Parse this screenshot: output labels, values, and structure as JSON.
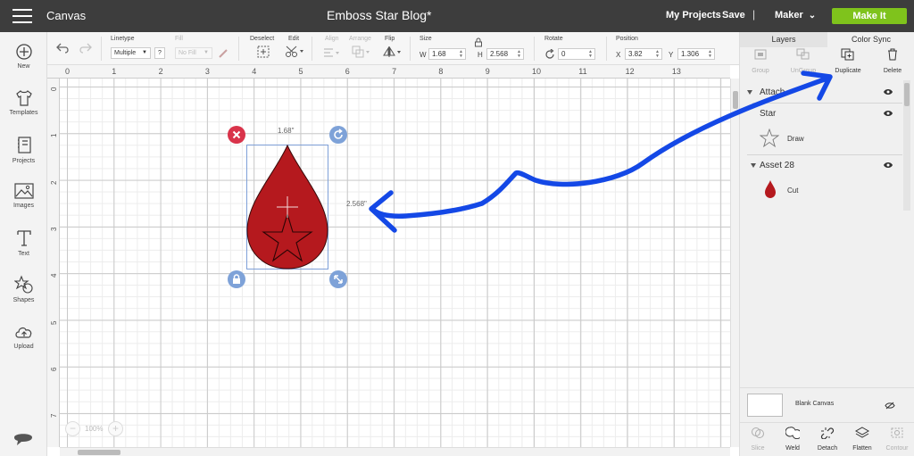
{
  "header": {
    "app_title": "Canvas",
    "doc_title": "Emboss Star Blog*",
    "my_projects": "My Projects",
    "save": "Save",
    "separator": "|",
    "machine": "Maker",
    "make_it": "Make It",
    "accent_color": "#7fc31c"
  },
  "sidebar": {
    "items": [
      {
        "label": "New",
        "icon": "plus-circle-icon"
      },
      {
        "label": "Templates",
        "icon": "shirt-icon"
      },
      {
        "label": "Projects",
        "icon": "projects-icon"
      },
      {
        "label": "Images",
        "icon": "image-icon"
      },
      {
        "label": "Text",
        "icon": "text-icon"
      },
      {
        "label": "Shapes",
        "icon": "shapes-icon"
      },
      {
        "label": "Upload",
        "icon": "upload-cloud-icon"
      }
    ]
  },
  "toolbar": {
    "linetype_label": "Linetype",
    "linetype_value": "Multiple",
    "linetype_help": "?",
    "fill_label": "Fill",
    "fill_value": "No Fill",
    "deselect_label": "Deselect",
    "edit_label": "Edit",
    "align_label": "Align",
    "arrange_label": "Arrange",
    "flip_label": "Flip",
    "size_label": "Size",
    "w_label": "W",
    "w_value": "1.68",
    "h_label": "H",
    "h_value": "2.568",
    "rotate_label": "Rotate",
    "rotate_value": "0",
    "position_label": "Position",
    "x_label": "X",
    "x_value": "3.82",
    "y_label": "Y",
    "y_value": "1.306"
  },
  "ruler": {
    "top": [
      "0",
      "1",
      "2",
      "3",
      "4",
      "5",
      "6",
      "7",
      "8",
      "9",
      "10",
      "11",
      "12",
      "13"
    ],
    "left": [
      "0",
      "1",
      "2",
      "3",
      "4",
      "5",
      "6",
      "7"
    ]
  },
  "canvas": {
    "width_label": "1.68\"",
    "height_label": "2.568\"",
    "zoom_value": "100%",
    "zoom_minus": "−",
    "zoom_plus": "+",
    "object_color": "#b5191e"
  },
  "panel": {
    "tabs": [
      "Layers",
      "Color Sync"
    ],
    "tools": [
      {
        "label": "Group",
        "enabled": false
      },
      {
        "label": "UnGroup",
        "enabled": false
      },
      {
        "label": "Duplicate",
        "enabled": true
      },
      {
        "label": "Delete",
        "enabled": true
      }
    ],
    "layers": {
      "group_name": "Attach",
      "star_name": "Star",
      "star_op": "Draw",
      "asset_name": "Asset 28",
      "asset_op": "Cut"
    },
    "blank_canvas": "Blank Canvas",
    "bottom_tools": [
      {
        "label": "Slice",
        "enabled": false
      },
      {
        "label": "Weld",
        "enabled": true
      },
      {
        "label": "Detach",
        "enabled": true
      },
      {
        "label": "Flatten",
        "enabled": true
      },
      {
        "label": "Contour",
        "enabled": false
      }
    ]
  },
  "annotation": {
    "arrow_color": "#1448e6"
  }
}
